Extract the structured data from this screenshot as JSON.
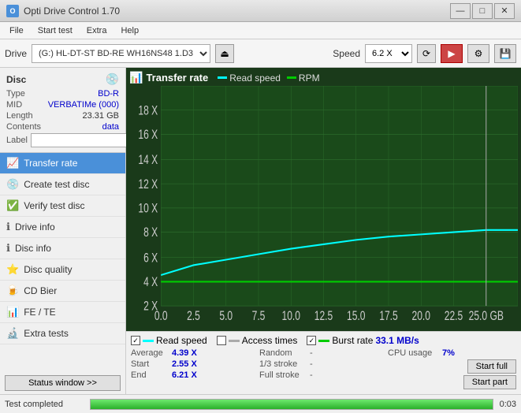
{
  "titlebar": {
    "title": "Opti Drive Control 1.70",
    "minimize": "—",
    "maximize": "□",
    "close": "✕"
  },
  "menu": {
    "items": [
      "File",
      "Start test",
      "Extra",
      "Help"
    ]
  },
  "toolbar": {
    "drive_label": "Drive",
    "drive_value": "(G:)  HL-DT-ST BD-RE  WH16NS48 1.D3",
    "speed_label": "Speed",
    "speed_value": "6.2 X"
  },
  "disc": {
    "title": "Disc",
    "type_label": "Type",
    "type_value": "BD-R",
    "mid_label": "MID",
    "mid_value": "VERBATIMe (000)",
    "length_label": "Length",
    "length_value": "23.31 GB",
    "contents_label": "Contents",
    "contents_value": "data",
    "label_label": "Label",
    "label_value": ""
  },
  "nav": {
    "items": [
      {
        "id": "transfer-rate",
        "label": "Transfer rate",
        "active": true
      },
      {
        "id": "create-test-disc",
        "label": "Create test disc",
        "active": false
      },
      {
        "id": "verify-test-disc",
        "label": "Verify test disc",
        "active": false
      },
      {
        "id": "drive-info",
        "label": "Drive info",
        "active": false
      },
      {
        "id": "disc-info",
        "label": "Disc info",
        "active": false
      },
      {
        "id": "disc-quality",
        "label": "Disc quality",
        "active": false
      },
      {
        "id": "cd-bier",
        "label": "CD Bier",
        "active": false
      },
      {
        "id": "fe-te",
        "label": "FE / TE",
        "active": false
      },
      {
        "id": "extra-tests",
        "label": "Extra tests",
        "active": false
      }
    ],
    "status_btn": "Status window >>"
  },
  "chart": {
    "title": "Transfer rate",
    "legend": {
      "read_speed": "Read speed",
      "rpm": "RPM"
    },
    "y_axis": [
      "18 X",
      "16 X",
      "14 X",
      "12 X",
      "10 X",
      "8 X",
      "6 X",
      "4 X",
      "2 X"
    ],
    "x_axis": [
      "0.0",
      "2.5",
      "5.0",
      "7.5",
      "10.0",
      "12.5",
      "15.0",
      "17.5",
      "20.0",
      "22.5",
      "25.0 GB"
    ]
  },
  "stats": {
    "legend_items": [
      {
        "label": "Read speed",
        "checked": true,
        "color": "#00ffff"
      },
      {
        "label": "Access times",
        "checked": false,
        "color": "#cccccc"
      },
      {
        "label": "Burst rate",
        "checked": true,
        "color": "#00aa00"
      }
    ],
    "burst_rate": "33.1 MB/s",
    "rows": [
      {
        "key": "Average",
        "value": "4.39 X",
        "key2": "Random",
        "value2": "-",
        "key3": "CPU usage",
        "value3": "7%"
      },
      {
        "key": "Start",
        "value": "2.55 X",
        "key2": "1/3 stroke",
        "value2": "-",
        "btn": "Start full"
      },
      {
        "key": "End",
        "value": "6.21 X",
        "key2": "Full stroke",
        "value2": "-",
        "btn": "Start part"
      }
    ]
  },
  "statusbar": {
    "text": "Test completed",
    "progress": 100,
    "time": "0:03"
  }
}
